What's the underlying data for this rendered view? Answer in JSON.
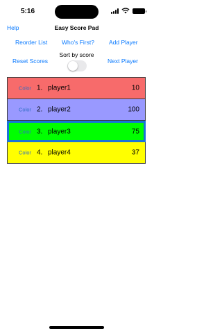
{
  "status": {
    "time": "5:16"
  },
  "header": {
    "help": "Help",
    "title": "Easy Score Pad",
    "reorder": "Reorder List",
    "whos_first": "Who's First?",
    "add_player": "Add Player",
    "reset": "Reset Scores",
    "sort_label": "Sort by score",
    "next_player": "Next Player"
  },
  "sort_enabled": false,
  "colors": {
    "accent": "#0a7aff",
    "player1": "#f76b6b",
    "player2": "#9999ff",
    "player3": "#00ff00",
    "player4": "#ffff00",
    "selected_border": "#1a73d9"
  },
  "players": [
    {
      "color_label": "Color",
      "num": "1.",
      "name": "player1",
      "score": "10"
    },
    {
      "color_label": "Color",
      "num": "2.",
      "name": "player2",
      "score": "100"
    },
    {
      "color_label": "Color",
      "num": "3.",
      "name": "player3",
      "score": "75"
    },
    {
      "color_label": "Color",
      "num": "4.",
      "name": "player4",
      "score": "37"
    }
  ]
}
